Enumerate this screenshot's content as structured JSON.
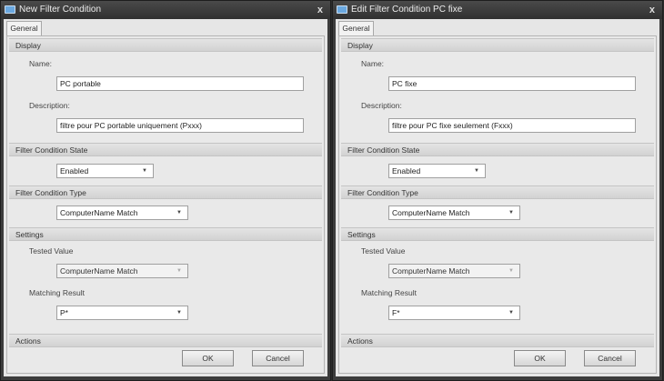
{
  "dialogs": [
    {
      "title": "New Filter Condition",
      "tab": "General",
      "sections": {
        "display": "Display",
        "state": "Filter Condition State",
        "type": "Filter Condition Type",
        "settings": "Settings",
        "actions": "Actions"
      },
      "name_label": "Name:",
      "name_value": "PC portable",
      "description_label": "Description:",
      "description_value": "filtre pour PC portable uniquement (Pxxx)",
      "state_value": "Enabled",
      "type_value": "ComputerName Match",
      "tested_value_label": "Tested Value",
      "tested_value": "ComputerName Match",
      "matching_result_label": "Matching Result",
      "matching_result_value": "P*",
      "ok": "OK",
      "cancel": "Cancel",
      "close": "x"
    },
    {
      "title": "Edit Filter Condition PC fixe",
      "tab": "General",
      "sections": {
        "display": "Display",
        "state": "Filter Condition State",
        "type": "Filter Condition Type",
        "settings": "Settings",
        "actions": "Actions"
      },
      "name_label": "Name:",
      "name_value": "PC fixe",
      "description_label": "Description:",
      "description_value": "filtre pour PC fixe seulement (Fxxx)",
      "state_value": "Enabled",
      "type_value": "ComputerName Match",
      "tested_value_label": "Tested Value",
      "tested_value": "ComputerName Match",
      "matching_result_label": "Matching Result",
      "matching_result_value": "F*",
      "ok": "OK",
      "cancel": "Cancel",
      "close": "x"
    }
  ]
}
